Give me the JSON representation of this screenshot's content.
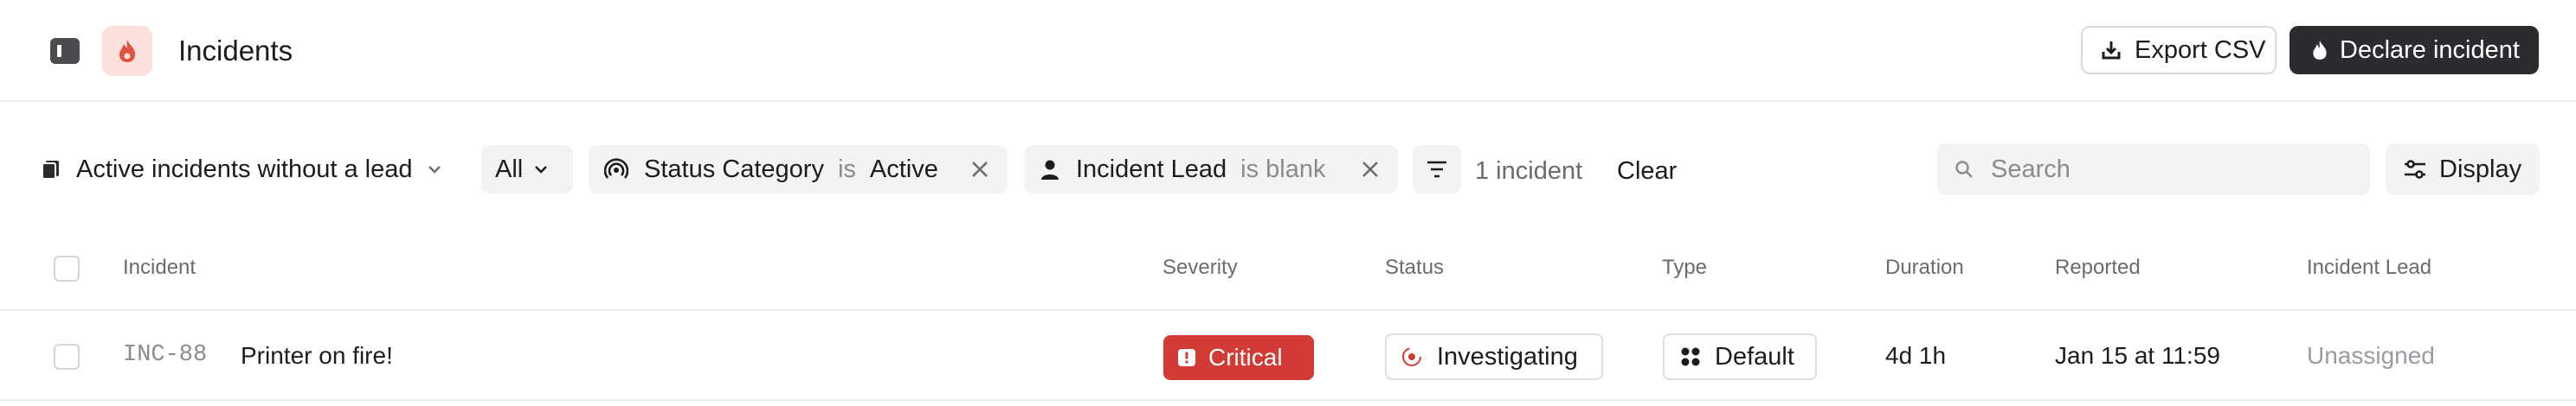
{
  "header": {
    "title": "Incidents",
    "export_label": "Export CSV",
    "declare_label": "Declare incident"
  },
  "filters": {
    "view_name": "Active incidents without a lead",
    "scope": "All",
    "status_chip": {
      "field": "Status Category",
      "operator": "is",
      "value": "Active"
    },
    "lead_chip": {
      "field": "Incident Lead",
      "operator": "is blank"
    },
    "count": "1 incident",
    "clear_label": "Clear",
    "search_placeholder": "Search",
    "display_label": "Display"
  },
  "table": {
    "columns": [
      "Incident",
      "Severity",
      "Status",
      "Type",
      "Duration",
      "Reported",
      "Incident Lead"
    ],
    "rows": [
      {
        "id": "INC-88",
        "name": "Printer on fire!",
        "severity": "Critical",
        "status": "Investigating",
        "type": "Default",
        "duration": "4d 1h",
        "reported": "Jan 15 at 11:59",
        "lead": "Unassigned"
      }
    ]
  },
  "colors": {
    "accent_dark": "#2b2b30",
    "critical": "#d23b35",
    "app_icon_bg": "#fbe0dc",
    "app_icon_fg": "#e0523f",
    "muted_text": "#8a8a90"
  },
  "icons": {
    "sidebar_toggle": "sidebar-toggle-icon",
    "app": "flame-icon",
    "export": "download-icon",
    "declare": "flame-icon",
    "view": "stack-icon",
    "status": "signal-icon",
    "lead": "person-icon",
    "filter": "filter-icon",
    "search": "search-icon",
    "display": "sliders-icon",
    "severity": "alert-icon",
    "status_pill": "target-icon",
    "type": "grid-icon"
  }
}
